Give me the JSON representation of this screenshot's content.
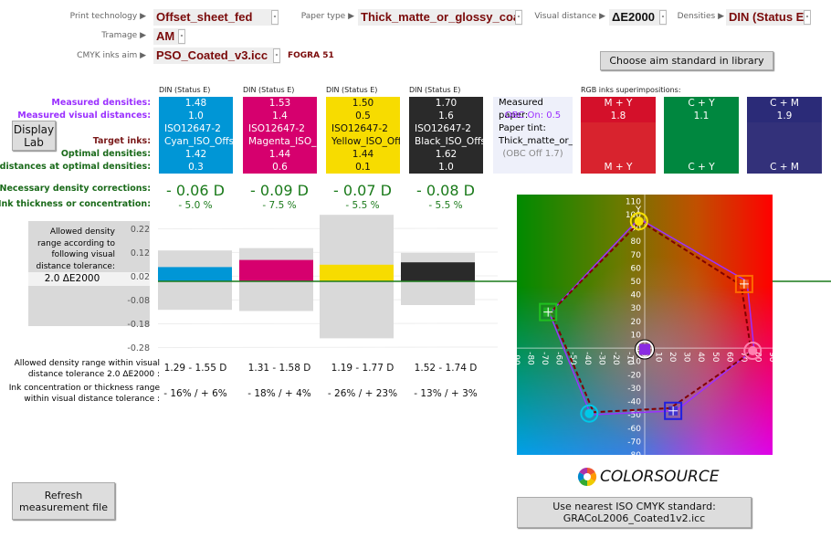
{
  "settings": {
    "print_technology": {
      "label": "Print technology ▶",
      "value": "Offset_sheet_fed"
    },
    "paper_type": {
      "label": "Paper type ▶",
      "value": "Thick_matte_or_glossy_coated"
    },
    "visual_distance": {
      "label": "Visual distance ▶",
      "value": "ΔE2000"
    },
    "densities": {
      "label": "Densities ▶",
      "value": "DIN (Status E)"
    },
    "tramage": {
      "label": "Tramage ▶",
      "value": "AM"
    },
    "cmyk_aim": {
      "label": "CMYK inks aim ▶",
      "value": "PSO_Coated_v3.icc",
      "note": "FOGRA 51"
    },
    "dropdown_glyph": "-"
  },
  "buttons": {
    "choose_aim": "Choose aim standard in library",
    "display_lab": "Display Lab",
    "refresh": "Refresh measurement file",
    "nearest_line1": "Use nearest ISO CMYK standard:",
    "nearest_line2": "GRACoL2006_Coated1v2.icc"
  },
  "row_labels": {
    "measured_densities": "Measured densities:",
    "measured_distances": "Measured visual distances:",
    "target_inks": "Target inks:",
    "optimal_densities": "Optimal densities:",
    "distances_optimal": "Visual distances at optimal densities:",
    "corrections": "Necessary density corrections:",
    "ink_thickness": "Ink thickness or concentration:",
    "allowed_range": "Allowed density range within visual distance tolerance 2.0 ΔE2000 :",
    "ink_range": "Ink concentration or thickness range within visual distance tolerance :"
  },
  "inks": [
    {
      "header": "DIN (Status E)",
      "color": "#0096d6",
      "text_color": "#ffffff",
      "measured": "1.48",
      "distance": "1.0",
      "target1": "ISO12647-2",
      "target2": "Cyan_ISO_Offset",
      "optimal": "1.42",
      "opt_distance": "0.3",
      "correction": "- 0.06 D",
      "thickness": "- 5.0 %",
      "range": "1.29 - 1.55 D",
      "ink_range": "- 16% / + 6%"
    },
    {
      "header": "DIN (Status E)",
      "color": "#d6006e",
      "text_color": "#ffffff",
      "measured": "1.53",
      "distance": "1.4",
      "target1": "ISO12647-2",
      "target2": "Magenta_ISO_Offset",
      "optimal": "1.44",
      "opt_distance": "0.6",
      "correction": "- 0.09 D",
      "thickness": "- 7.5 %",
      "range": "1.31 - 1.58 D",
      "ink_range": "- 18% / + 4%"
    },
    {
      "header": "DIN (Status E)",
      "color": "#f7dc00",
      "text_color": "#111111",
      "measured": "1.50",
      "distance": "0.5",
      "target1": "ISO12647-2",
      "target2": "Yellow_ISO_Offset",
      "optimal": "1.44",
      "opt_distance": "0.1",
      "correction": "- 0.07 D",
      "thickness": "- 5.5 %",
      "range": "1.19 - 1.77 D",
      "ink_range": "- 26% / + 23%"
    },
    {
      "header": "DIN (Status E)",
      "color": "#2a2a2a",
      "text_color": "#ffffff",
      "measured": "1.70",
      "distance": "1.6",
      "target1": "ISO12647-2",
      "target2": "Black_ISO_Offset",
      "optimal": "1.62",
      "opt_distance": "1.0",
      "correction": "- 0.08 D",
      "thickness": "- 5.5 %",
      "range": "1.52 - 1.74 D",
      "ink_range": "- 13% / + 3%"
    }
  ],
  "paper": {
    "title": "Measured paper:",
    "obc_on": "OBC On: 0.5",
    "tint_label": "Paper tint:",
    "tint": "Thick_matte_or_glossy_coated",
    "obc_off": "(OBC Off 1.7)"
  },
  "rgb": {
    "title": "RGB inks superimpositions:",
    "items": [
      {
        "name": "M + Y",
        "value": "1.8",
        "color": "#d8232e",
        "top": "#d4102a"
      },
      {
        "name": "C + Y",
        "value": "1.1",
        "color": "#00873f",
        "top": "#00873f"
      },
      {
        "name": "C + M",
        "value": "1.9",
        "color": "#33317a",
        "top": "#2b2b78"
      }
    ]
  },
  "tolerance": {
    "text": "Allowed density range according to following visual distance tolerance:",
    "value": "2.0 ΔE2000"
  },
  "chart_data": [
    {
      "type": "bar",
      "categories": [
        "Cyan",
        "Magenta",
        "Yellow",
        "Black"
      ],
      "values": [
        0.06,
        0.09,
        0.07,
        0.08
      ],
      "allowed_range": [
        [
          -0.12,
          0.13
        ],
        [
          -0.125,
          0.14
        ],
        [
          -0.24,
          0.28
        ],
        [
          -0.1,
          0.12
        ]
      ],
      "yticks": [
        0.22,
        0.12,
        0.02,
        -0.08,
        -0.18,
        -0.28
      ],
      "ylim": [
        -0.3,
        0.28
      ],
      "grid": true,
      "colors": [
        "#0096d6",
        "#d6006e",
        "#f7dc00",
        "#2a2a2a"
      ]
    },
    {
      "type": "scatter",
      "xlim": [
        -90,
        90
      ],
      "ylim": [
        -80,
        115
      ],
      "xticks": [
        -90,
        -80,
        -70,
        -60,
        -50,
        -40,
        -30,
        -20,
        -10,
        0,
        10,
        20,
        30,
        40,
        50,
        60,
        70,
        80,
        90
      ],
      "yticks": [
        110,
        100,
        90,
        80,
        70,
        60,
        50,
        40,
        30,
        20,
        10,
        0,
        -10,
        -20,
        -30,
        -40,
        -50,
        -60,
        -70,
        -80
      ],
      "axis_label_y": "Y",
      "points": [
        {
          "ink": "Yellow",
          "a": -4,
          "b": 95,
          "shape": "circle",
          "color": "#f7e000"
        },
        {
          "ink": "M+Y",
          "a": 70,
          "b": 48,
          "shape": "square",
          "color": "#ff6a00"
        },
        {
          "ink": "Magenta",
          "a": 76,
          "b": -2,
          "shape": "circle",
          "color": "#ff80b0"
        },
        {
          "ink": "C+M",
          "a": 20,
          "b": -47,
          "shape": "square",
          "color": "#2020e0"
        },
        {
          "ink": "Cyan",
          "a": -39,
          "b": -49,
          "shape": "circle",
          "color": "#00c8e8"
        },
        {
          "ink": "C+Y",
          "a": -68,
          "b": 27,
          "shape": "square",
          "color": "#20c020"
        },
        {
          "ink": "Paper",
          "a": 0,
          "b": -1,
          "shape": "circle",
          "color": "#8a2be2"
        }
      ],
      "measured_polygon": [
        [
          -4,
          97
        ],
        [
          72,
          50
        ],
        [
          77,
          -1
        ],
        [
          22,
          -47
        ],
        [
          -38,
          -50
        ],
        [
          -67,
          26
        ]
      ],
      "target_polygon": [
        [
          -3,
          95
        ],
        [
          68,
          47
        ],
        [
          75,
          -3
        ],
        [
          18,
          -45
        ],
        [
          -36,
          -48
        ],
        [
          -66,
          27
        ]
      ],
      "measured_color": "#9b30ff",
      "target_color": "#800000"
    }
  ],
  "logo": {
    "text": "COLORSOURCE"
  }
}
